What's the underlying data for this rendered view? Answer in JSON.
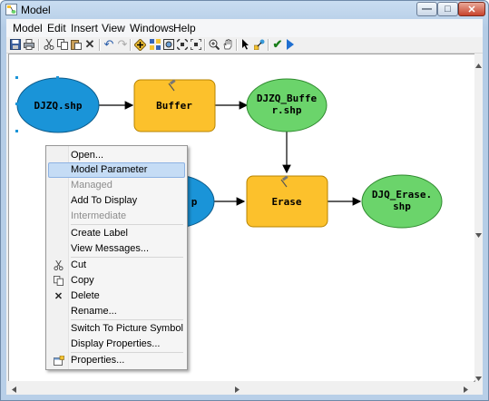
{
  "window": {
    "title": "Model",
    "minimize_label": "—",
    "maximize_label": "□",
    "close_label": "✕"
  },
  "menubar": [
    "Model",
    "Edit",
    "Insert",
    "View",
    "Windows",
    "Help"
  ],
  "toolbar": {
    "icons": [
      "save-icon",
      "print-icon",
      "cut-icon",
      "copy-icon",
      "paste-icon",
      "delete-icon",
      "undo-icon",
      "redo-icon",
      "add-data-icon",
      "auto-layout-icon",
      "full-extent-icon",
      "fixed-zoom-in-icon",
      "fixed-zoom-out-icon",
      "zoom-in-icon",
      "pan-icon",
      "select-icon",
      "connect-icon",
      "validate-icon",
      "run-icon"
    ]
  },
  "diagram": {
    "nodes": [
      {
        "id": "djzq",
        "label": "DJZQ.shp",
        "type": "input-data",
        "color": "#1a94d8"
      },
      {
        "id": "buffer",
        "label": "Buffer",
        "type": "tool",
        "color": "#fcc12c"
      },
      {
        "id": "djzq_buffer",
        "label_lines": [
          "DJZQ_Buffe",
          "r.shp"
        ],
        "type": "derived-data",
        "color": "#6bd46b"
      },
      {
        "id": "erase",
        "label": "Erase",
        "type": "tool",
        "color": "#fcc12c"
      },
      {
        "id": "djq_erase",
        "label_lines": [
          "DJQ_Erase.",
          "shp"
        ],
        "type": "derived-data",
        "color": "#6bd46b"
      },
      {
        "id": "erase_input",
        "label": "p",
        "type": "input-data",
        "color": "#1a94d8"
      }
    ]
  },
  "context_menu": {
    "items": [
      {
        "label": "Open...",
        "enabled": true
      },
      {
        "label": "Model Parameter",
        "enabled": true,
        "highlighted": true
      },
      {
        "label": "Managed",
        "enabled": false
      },
      {
        "label": "Add To Display",
        "enabled": true
      },
      {
        "label": "Intermediate",
        "enabled": false
      },
      {
        "label": "Create Label",
        "enabled": true
      },
      {
        "label": "View Messages...",
        "enabled": true
      },
      {
        "label": "Cut",
        "enabled": true,
        "icon": "scissors-icon"
      },
      {
        "label": "Copy",
        "enabled": true,
        "icon": "copy-icon"
      },
      {
        "label": "Delete",
        "enabled": true,
        "icon": "delete-icon"
      },
      {
        "label": "Rename...",
        "enabled": true
      },
      {
        "label": "Switch To Picture Symbol",
        "enabled": true
      },
      {
        "label": "Display Properties...",
        "enabled": true
      },
      {
        "label": "Properties...",
        "enabled": true,
        "icon": "properties-icon"
      }
    ]
  }
}
